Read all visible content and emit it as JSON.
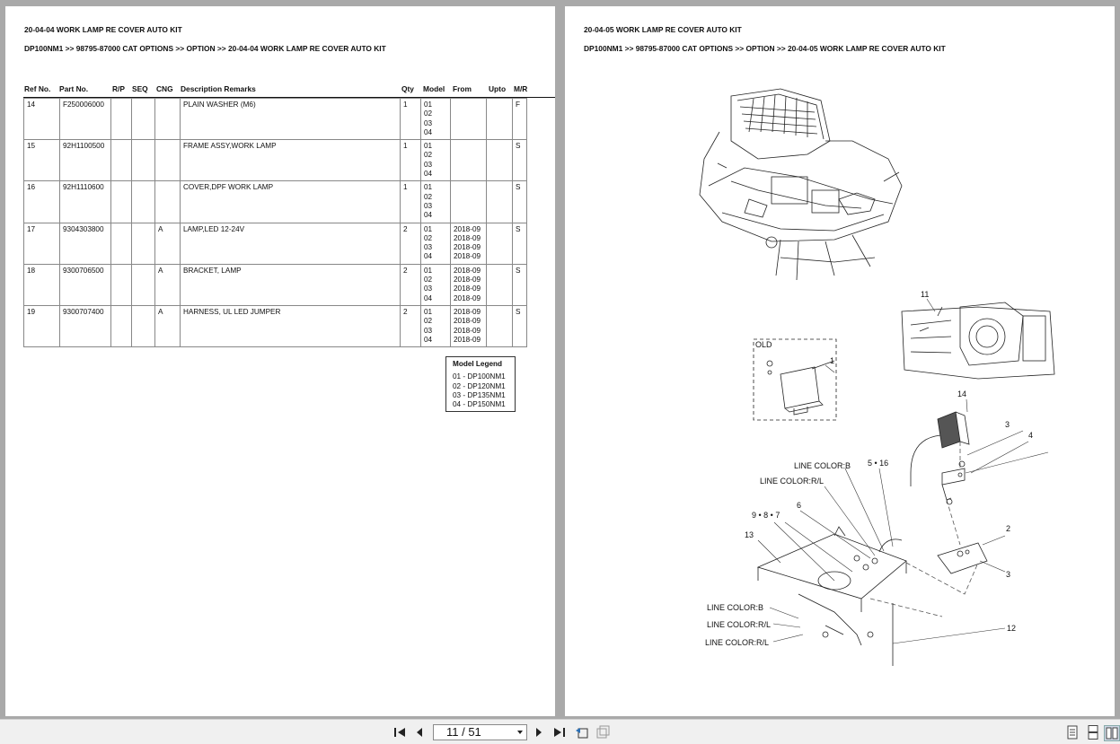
{
  "left_page": {
    "title": "20-04-04 WORK LAMP RE COVER AUTO KIT",
    "breadcrumb": "DP100NM1 >> 98795-87000 CAT OPTIONS >> OPTION >> 20-04-04 WORK LAMP RE COVER AUTO KIT",
    "columns": [
      "Ref No.",
      "Part No.",
      "R/P",
      "SEQ",
      "CNG",
      "Description Remarks",
      "Qty",
      "Model",
      "From",
      "Upto",
      "M/R"
    ],
    "rows": [
      {
        "ref": "14",
        "part": "F250006000",
        "rp": "",
        "seq": "",
        "cng": "",
        "desc": "PLAIN WASHER (M6)",
        "qty": "1",
        "models": [
          "01",
          "02",
          "03",
          "04"
        ],
        "from": [
          "",
          "",
          "",
          ""
        ],
        "upto": "",
        "mr": "F"
      },
      {
        "ref": "15",
        "part": "92H1100500",
        "rp": "",
        "seq": "",
        "cng": "",
        "desc": "FRAME ASSY,WORK LAMP",
        "qty": "1",
        "models": [
          "01",
          "02",
          "03",
          "04"
        ],
        "from": [
          "",
          "",
          "",
          ""
        ],
        "upto": "",
        "mr": "S"
      },
      {
        "ref": "16",
        "part": "92H1110600",
        "rp": "",
        "seq": "",
        "cng": "",
        "desc": "COVER,DPF WORK LAMP",
        "qty": "1",
        "models": [
          "01",
          "02",
          "03",
          "04"
        ],
        "from": [
          "",
          "",
          "",
          ""
        ],
        "upto": "",
        "mr": "S"
      },
      {
        "ref": "17",
        "part": "9304303800",
        "rp": "",
        "seq": "",
        "cng": "A",
        "desc": "LAMP,LED 12-24V",
        "qty": "2",
        "models": [
          "01",
          "02",
          "03",
          "04"
        ],
        "from": [
          "2018-09",
          "2018-09",
          "2018-09",
          "2018-09"
        ],
        "upto": "",
        "mr": "S"
      },
      {
        "ref": "18",
        "part": "9300706500",
        "rp": "",
        "seq": "",
        "cng": "A",
        "desc": "BRACKET, LAMP",
        "qty": "2",
        "models": [
          "01",
          "02",
          "03",
          "04"
        ],
        "from": [
          "2018-09",
          "2018-09",
          "2018-09",
          "2018-09"
        ],
        "upto": "",
        "mr": "S"
      },
      {
        "ref": "19",
        "part": "9300707400",
        "rp": "",
        "seq": "",
        "cng": "A",
        "desc": "HARNESS, UL LED JUMPER",
        "qty": "2",
        "models": [
          "01",
          "02",
          "03",
          "04"
        ],
        "from": [
          "2018-09",
          "2018-09",
          "2018-09",
          "2018-09"
        ],
        "upto": "",
        "mr": "S"
      }
    ],
    "legend": {
      "title": "Model Legend",
      "items": [
        "01 - DP100NM1",
        "02 - DP120NM1",
        "03 - DP135NM1",
        "04 - DP150NM1"
      ]
    }
  },
  "right_page": {
    "title": "20-04-05 WORK LAMP RE COVER AUTO KIT",
    "breadcrumb": "DP100NM1 >> 98795-87000 CAT OPTIONS >> OPTION >> 20-04-05 WORK LAMP RE COVER AUTO KIT",
    "diagram_labels": {
      "ref_11": "11",
      "old": "OLD",
      "ref_1": "1",
      "ref_14": "14",
      "ref_3a": "3",
      "ref_4": "4",
      "ref_5_16": "5 • 16",
      "line_color_b_top": "LINE COLOR:B",
      "line_color_rl_top": "LINE COLOR:R/L",
      "ref_6": "6",
      "ref_9_8_7": "9 • 8 • 7",
      "ref_13": "13",
      "ref_2": "2",
      "ref_3b": "3",
      "line_color_b_bottom": "LINE COLOR:B",
      "line_color_rl_mid": "LINE COLOR:R/L",
      "line_color_rl_bottom": "LINE COLOR:R/L",
      "ref_12": "12"
    }
  },
  "toolbar": {
    "page_indicator": "11 / 51",
    "icons": [
      "first-page-icon",
      "prev-page-icon",
      "next-page-icon",
      "last-page-icon",
      "prev-view-icon",
      "next-view-icon",
      "single-page-view-icon",
      "continuous-view-icon",
      "two-page-view-icon"
    ]
  }
}
